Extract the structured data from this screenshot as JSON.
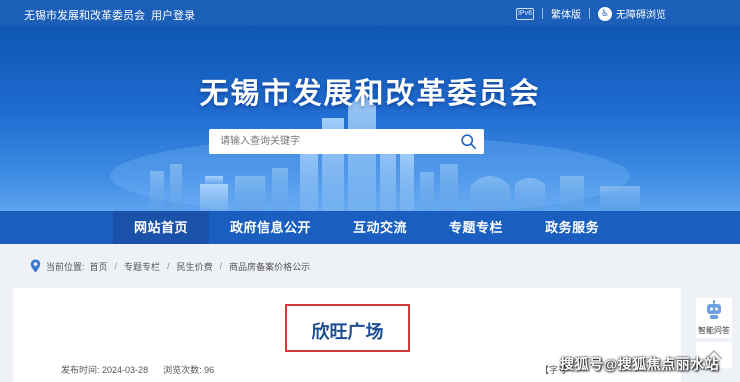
{
  "topbar": {
    "site_name": "无锡市发展和改革委员会",
    "login": "用户登录",
    "ipv6_badge": "IPv6",
    "traditional": "繁体版",
    "accessibility": "无障碍浏览"
  },
  "banner": {
    "title": "无锡市发展和改革委员会"
  },
  "search": {
    "placeholder": "请输入查询关键字",
    "icon": "search-icon"
  },
  "nav": {
    "items": [
      "网站首页",
      "政府信息公开",
      "互动交流",
      "专题专栏",
      "政务服务"
    ]
  },
  "breadcrumb": {
    "prefix": "当前位置:",
    "items": [
      "首页",
      "专题专栏",
      "民生价费",
      "商品房备案价格公示"
    ]
  },
  "article": {
    "title": "欣旺广场",
    "publish_label": "发布时间:",
    "publish_date": "2024-03-28",
    "views_label": "浏览次数:",
    "views": "96",
    "font_size_label": "【字号"
  },
  "side": {
    "assistant_label": "智能问答"
  },
  "watermark": "搜狐号@搜狐焦点丽水站",
  "colors": {
    "brand_blue": "#1c5fb8",
    "title_blue": "#1d4e92",
    "highlight_red": "#d33a3a"
  }
}
